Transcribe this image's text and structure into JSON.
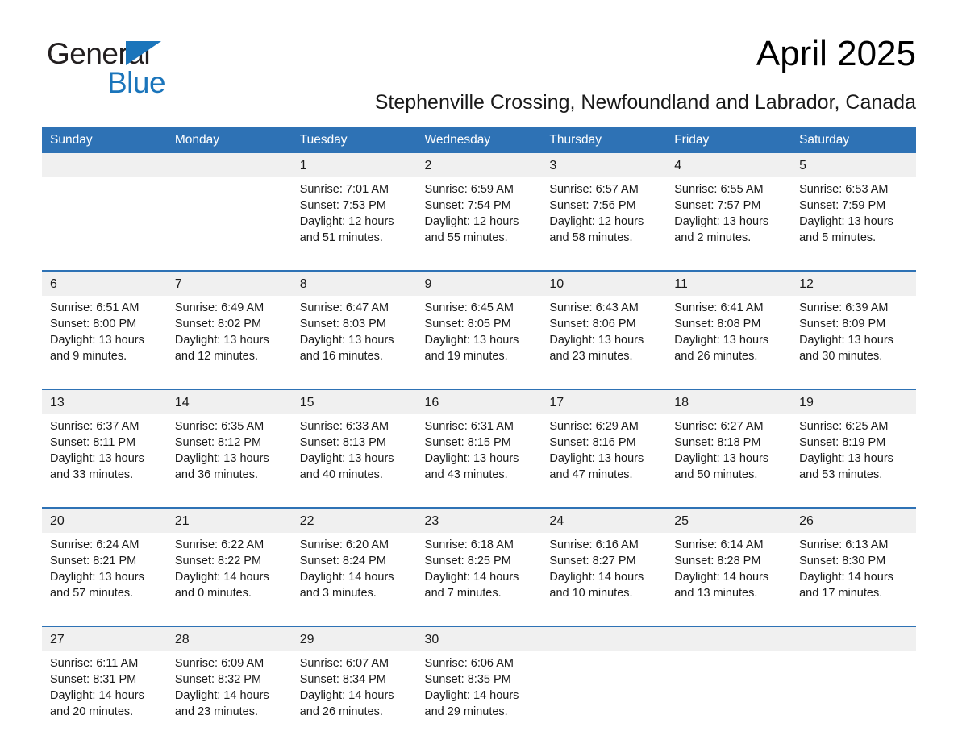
{
  "brand": {
    "name_part1": "General",
    "name_part2": "Blue",
    "triangle_color": "#1b75bb"
  },
  "header": {
    "month_title": "April 2025",
    "subtitle": "Stephenville Crossing, Newfoundland and Labrador, Canada"
  },
  "colors": {
    "header_blue": "#2e72b5",
    "date_band_gray": "#f0f0f0",
    "cell_white": "#ffffff",
    "text_dark": "#1a1a1a"
  },
  "weekday_headers": [
    "Sunday",
    "Monday",
    "Tuesday",
    "Wednesday",
    "Thursday",
    "Friday",
    "Saturday"
  ],
  "weeks": [
    {
      "dates": [
        "",
        "",
        "1",
        "2",
        "3",
        "4",
        "5"
      ],
      "cells": [
        {
          "lines": []
        },
        {
          "lines": []
        },
        {
          "lines": [
            "Sunrise: 7:01 AM",
            "Sunset: 7:53 PM",
            "Daylight: 12 hours",
            "and 51 minutes."
          ]
        },
        {
          "lines": [
            "Sunrise: 6:59 AM",
            "Sunset: 7:54 PM",
            "Daylight: 12 hours",
            "and 55 minutes."
          ]
        },
        {
          "lines": [
            "Sunrise: 6:57 AM",
            "Sunset: 7:56 PM",
            "Daylight: 12 hours",
            "and 58 minutes."
          ]
        },
        {
          "lines": [
            "Sunrise: 6:55 AM",
            "Sunset: 7:57 PM",
            "Daylight: 13 hours",
            "and 2 minutes."
          ]
        },
        {
          "lines": [
            "Sunrise: 6:53 AM",
            "Sunset: 7:59 PM",
            "Daylight: 13 hours",
            "and 5 minutes."
          ]
        }
      ]
    },
    {
      "dates": [
        "6",
        "7",
        "8",
        "9",
        "10",
        "11",
        "12"
      ],
      "cells": [
        {
          "lines": [
            "Sunrise: 6:51 AM",
            "Sunset: 8:00 PM",
            "Daylight: 13 hours",
            "and 9 minutes."
          ]
        },
        {
          "lines": [
            "Sunrise: 6:49 AM",
            "Sunset: 8:02 PM",
            "Daylight: 13 hours",
            "and 12 minutes."
          ]
        },
        {
          "lines": [
            "Sunrise: 6:47 AM",
            "Sunset: 8:03 PM",
            "Daylight: 13 hours",
            "and 16 minutes."
          ]
        },
        {
          "lines": [
            "Sunrise: 6:45 AM",
            "Sunset: 8:05 PM",
            "Daylight: 13 hours",
            "and 19 minutes."
          ]
        },
        {
          "lines": [
            "Sunrise: 6:43 AM",
            "Sunset: 8:06 PM",
            "Daylight: 13 hours",
            "and 23 minutes."
          ]
        },
        {
          "lines": [
            "Sunrise: 6:41 AM",
            "Sunset: 8:08 PM",
            "Daylight: 13 hours",
            "and 26 minutes."
          ]
        },
        {
          "lines": [
            "Sunrise: 6:39 AM",
            "Sunset: 8:09 PM",
            "Daylight: 13 hours",
            "and 30 minutes."
          ]
        }
      ]
    },
    {
      "dates": [
        "13",
        "14",
        "15",
        "16",
        "17",
        "18",
        "19"
      ],
      "cells": [
        {
          "lines": [
            "Sunrise: 6:37 AM",
            "Sunset: 8:11 PM",
            "Daylight: 13 hours",
            "and 33 minutes."
          ]
        },
        {
          "lines": [
            "Sunrise: 6:35 AM",
            "Sunset: 8:12 PM",
            "Daylight: 13 hours",
            "and 36 minutes."
          ]
        },
        {
          "lines": [
            "Sunrise: 6:33 AM",
            "Sunset: 8:13 PM",
            "Daylight: 13 hours",
            "and 40 minutes."
          ]
        },
        {
          "lines": [
            "Sunrise: 6:31 AM",
            "Sunset: 8:15 PM",
            "Daylight: 13 hours",
            "and 43 minutes."
          ]
        },
        {
          "lines": [
            "Sunrise: 6:29 AM",
            "Sunset: 8:16 PM",
            "Daylight: 13 hours",
            "and 47 minutes."
          ]
        },
        {
          "lines": [
            "Sunrise: 6:27 AM",
            "Sunset: 8:18 PM",
            "Daylight: 13 hours",
            "and 50 minutes."
          ]
        },
        {
          "lines": [
            "Sunrise: 6:25 AM",
            "Sunset: 8:19 PM",
            "Daylight: 13 hours",
            "and 53 minutes."
          ]
        }
      ]
    },
    {
      "dates": [
        "20",
        "21",
        "22",
        "23",
        "24",
        "25",
        "26"
      ],
      "cells": [
        {
          "lines": [
            "Sunrise: 6:24 AM",
            "Sunset: 8:21 PM",
            "Daylight: 13 hours",
            "and 57 minutes."
          ]
        },
        {
          "lines": [
            "Sunrise: 6:22 AM",
            "Sunset: 8:22 PM",
            "Daylight: 14 hours",
            "and 0 minutes."
          ]
        },
        {
          "lines": [
            "Sunrise: 6:20 AM",
            "Sunset: 8:24 PM",
            "Daylight: 14 hours",
            "and 3 minutes."
          ]
        },
        {
          "lines": [
            "Sunrise: 6:18 AM",
            "Sunset: 8:25 PM",
            "Daylight: 14 hours",
            "and 7 minutes."
          ]
        },
        {
          "lines": [
            "Sunrise: 6:16 AM",
            "Sunset: 8:27 PM",
            "Daylight: 14 hours",
            "and 10 minutes."
          ]
        },
        {
          "lines": [
            "Sunrise: 6:14 AM",
            "Sunset: 8:28 PM",
            "Daylight: 14 hours",
            "and 13 minutes."
          ]
        },
        {
          "lines": [
            "Sunrise: 6:13 AM",
            "Sunset: 8:30 PM",
            "Daylight: 14 hours",
            "and 17 minutes."
          ]
        }
      ]
    },
    {
      "dates": [
        "27",
        "28",
        "29",
        "30",
        "",
        "",
        ""
      ],
      "cells": [
        {
          "lines": [
            "Sunrise: 6:11 AM",
            "Sunset: 8:31 PM",
            "Daylight: 14 hours",
            "and 20 minutes."
          ]
        },
        {
          "lines": [
            "Sunrise: 6:09 AM",
            "Sunset: 8:32 PM",
            "Daylight: 14 hours",
            "and 23 minutes."
          ]
        },
        {
          "lines": [
            "Sunrise: 6:07 AM",
            "Sunset: 8:34 PM",
            "Daylight: 14 hours",
            "and 26 minutes."
          ]
        },
        {
          "lines": [
            "Sunrise: 6:06 AM",
            "Sunset: 8:35 PM",
            "Daylight: 14 hours",
            "and 29 minutes."
          ]
        },
        {
          "lines": []
        },
        {
          "lines": []
        },
        {
          "lines": []
        }
      ]
    }
  ]
}
